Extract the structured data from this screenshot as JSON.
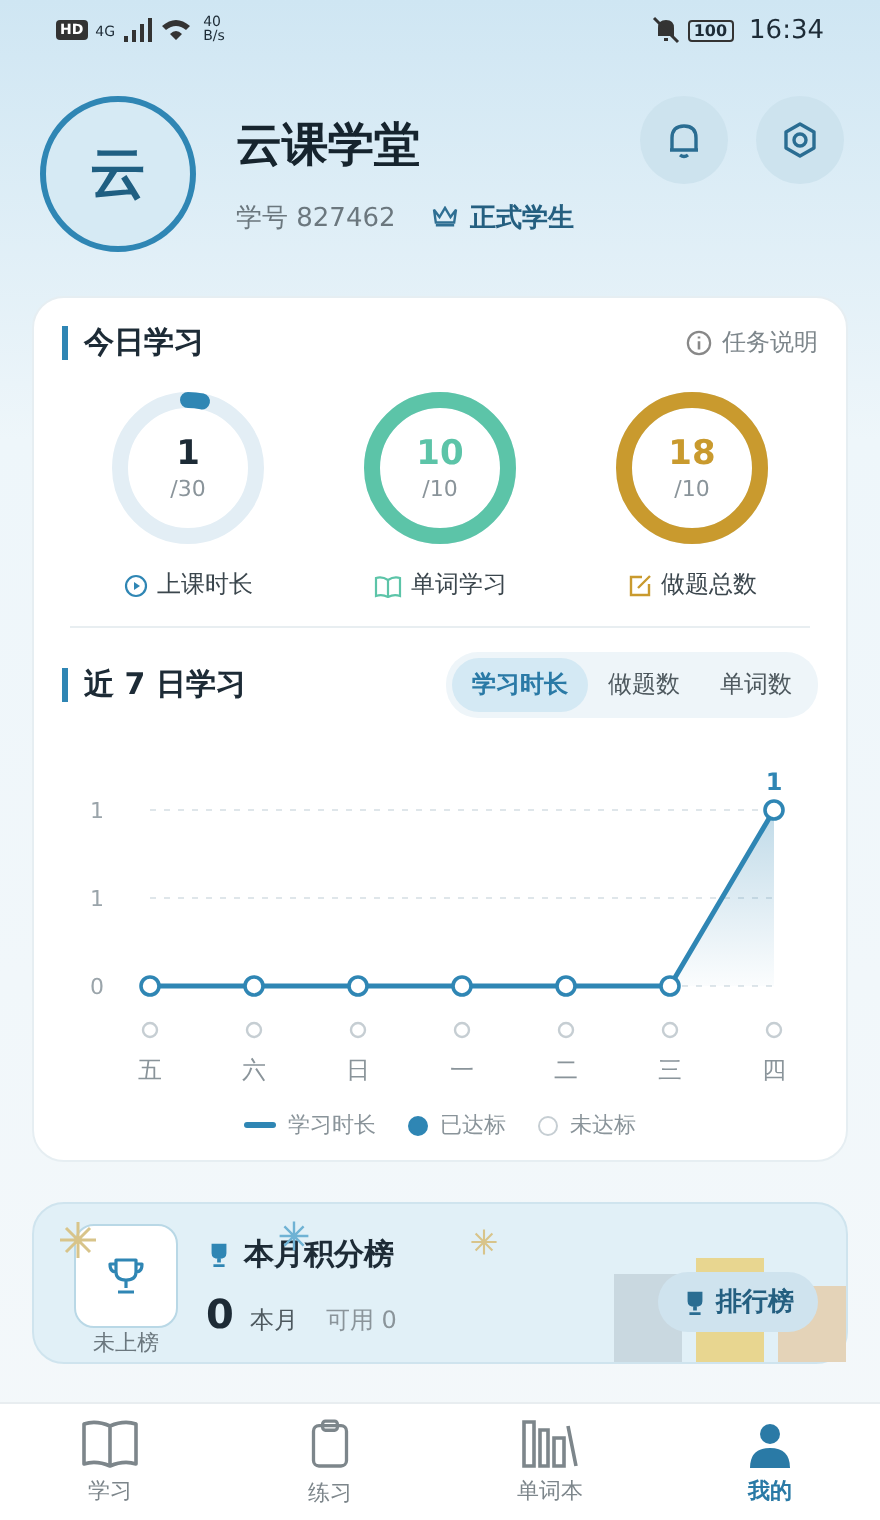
{
  "status_bar": {
    "left": [
      "HD",
      "4G"
    ],
    "speed": "40",
    "speed_unit": "B/s",
    "battery": "100",
    "time": "16:34"
  },
  "profile": {
    "avatar_text": "云",
    "name": "云课学堂",
    "id_label": "学号 827462",
    "badge": "正式学生"
  },
  "today": {
    "title": "今日学习",
    "help": "任务说明",
    "rings": [
      {
        "value": "1",
        "target": "/30",
        "level": 0.033,
        "color": "#2f86b4",
        "label": "上课时长",
        "kind": "play"
      },
      {
        "value": "10",
        "target": "/10",
        "level": 1,
        "color": "#5cc4a8",
        "label": "单词学习",
        "kind": "book"
      },
      {
        "value": "18",
        "target": "/10",
        "level": 1,
        "color": "#c99a2e",
        "label": "做题总数",
        "kind": "edit"
      }
    ]
  },
  "week": {
    "title": "近 7 日学习",
    "tabs": [
      {
        "label": "学习时长",
        "selected": true
      },
      {
        "label": "做题数",
        "selected": false
      },
      {
        "label": "单词数",
        "selected": false
      }
    ],
    "chart_data": {
      "type": "line",
      "categories": [
        "五",
        "六",
        "日",
        "一",
        "二",
        "三",
        "四"
      ],
      "series": [
        {
          "name": "学习时长",
          "color": "#2f86b4",
          "marker": "circle",
          "values": [
            0,
            0,
            0,
            0,
            0,
            0,
            1
          ]
        }
      ],
      "ylim": [
        0,
        1
      ],
      "yticks": [
        {
          "value": 0,
          "label": "0"
        },
        {
          "value": 0.5,
          "label": "1"
        },
        {
          "value": 1,
          "label": "1"
        }
      ],
      "value_labels": [
        null,
        null,
        null,
        null,
        null,
        null,
        "1"
      ]
    },
    "days_met": [
      false,
      false,
      false,
      false,
      false,
      false,
      false
    ],
    "legend": {
      "met": "已达标",
      "unmet": "未达标"
    }
  },
  "rank": {
    "status": "未上榜",
    "title": "本月积分榜",
    "points": "0",
    "points_label": "本月",
    "available": "可用 0",
    "button": "排行榜"
  },
  "nav": [
    {
      "label": "学习",
      "kind": "book",
      "selected": false
    },
    {
      "label": "练习",
      "kind": "clipboard",
      "selected": false
    },
    {
      "label": "单词本",
      "kind": "shelf",
      "selected": false
    },
    {
      "label": "我的",
      "kind": "person",
      "selected": true
    }
  ]
}
